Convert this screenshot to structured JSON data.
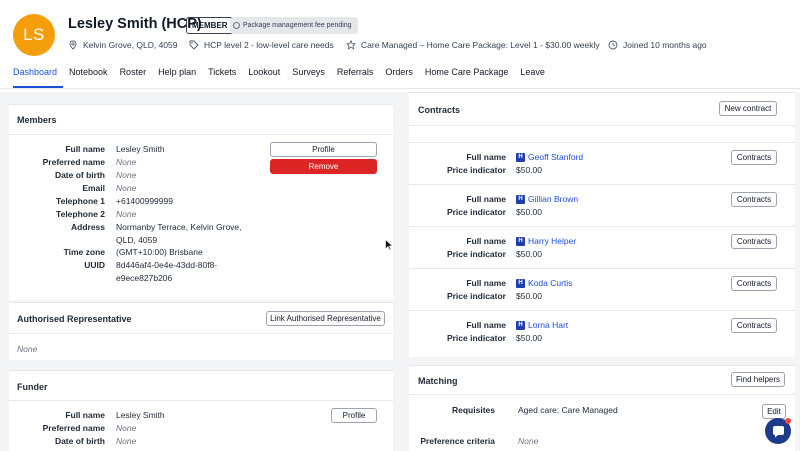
{
  "profile": {
    "initials": "LS",
    "name": "Lesley Smith (HCP)",
    "member_badge": "MEMBER",
    "pending_badge": "Package management fee pending",
    "location": "Kelvin Grove, QLD, 4059",
    "care_level": "HCP level 2 - low-level care needs",
    "package": "Care Managed – Home Care Package: Level 1 - $30.00 weekly",
    "joined": "Joined 10 months ago",
    "avatar_color": "#f59e0b"
  },
  "tabs": [
    "Dashboard",
    "Notebook",
    "Roster",
    "Help plan",
    "Tickets",
    "Lookout",
    "Surveys",
    "Referrals",
    "Orders",
    "Home Care Package",
    "Leave"
  ],
  "members": {
    "title": "Members",
    "profile_button": "Profile",
    "remove_button": "Remove",
    "fields": [
      {
        "label": "Full name",
        "value": "Lesley Smith",
        "none": false
      },
      {
        "label": "Preferred name",
        "value": "None",
        "none": true
      },
      {
        "label": "Date of birth",
        "value": "None",
        "none": true
      },
      {
        "label": "Email",
        "value": "None",
        "none": true
      },
      {
        "label": "Telephone 1",
        "value": "+61400999999",
        "none": false
      },
      {
        "label": "Telephone 2",
        "value": "None",
        "none": true
      }
    ],
    "address_label": "Address",
    "address_line1": "Normanby Terrace, Kelvin Grove,",
    "address_line2": "QLD, 4059",
    "timezone_label": "Time zone",
    "timezone": "(GMT+10:00) Brisbane",
    "uuid_label": "UUID",
    "uuid_line1": "8d446af4-0e4e-43dd-80f8-",
    "uuid_line2": "e9ece827b206"
  },
  "authorised": {
    "title": "Authorised Representative",
    "link_button": "Link Authorised Representative",
    "empty": "None"
  },
  "funder": {
    "title": "Funder",
    "profile_button": "Profile",
    "fields": [
      {
        "label": "Full name",
        "value": "Lesley Smith",
        "none": false
      },
      {
        "label": "Preferred name",
        "value": "None",
        "none": true
      },
      {
        "label": "Date of birth",
        "value": "None",
        "none": true
      }
    ]
  },
  "contracts": {
    "title": "Contracts",
    "new_button": "New contract",
    "full_name_label": "Full name",
    "price_label": "Price indicator",
    "row_button": "Contracts",
    "helper_badge": "H",
    "rows": [
      {
        "name": "Geoff Stanford",
        "price": "$50.00"
      },
      {
        "name": "Gillian Brown",
        "price": "$50.00"
      },
      {
        "name": "Harry Helper",
        "price": "$50.00"
      },
      {
        "name": "Koda Curtis",
        "price": "$50.00"
      },
      {
        "name": "Lorna Hart",
        "price": "$50.00"
      }
    ]
  },
  "matching": {
    "title": "Matching",
    "find_button": "Find helpers",
    "requisites_label": "Requisites",
    "requisites_value": "Aged care: Care Managed",
    "edit_button": "Edit",
    "preference_label": "Preference criteria",
    "preference_value": "None"
  }
}
